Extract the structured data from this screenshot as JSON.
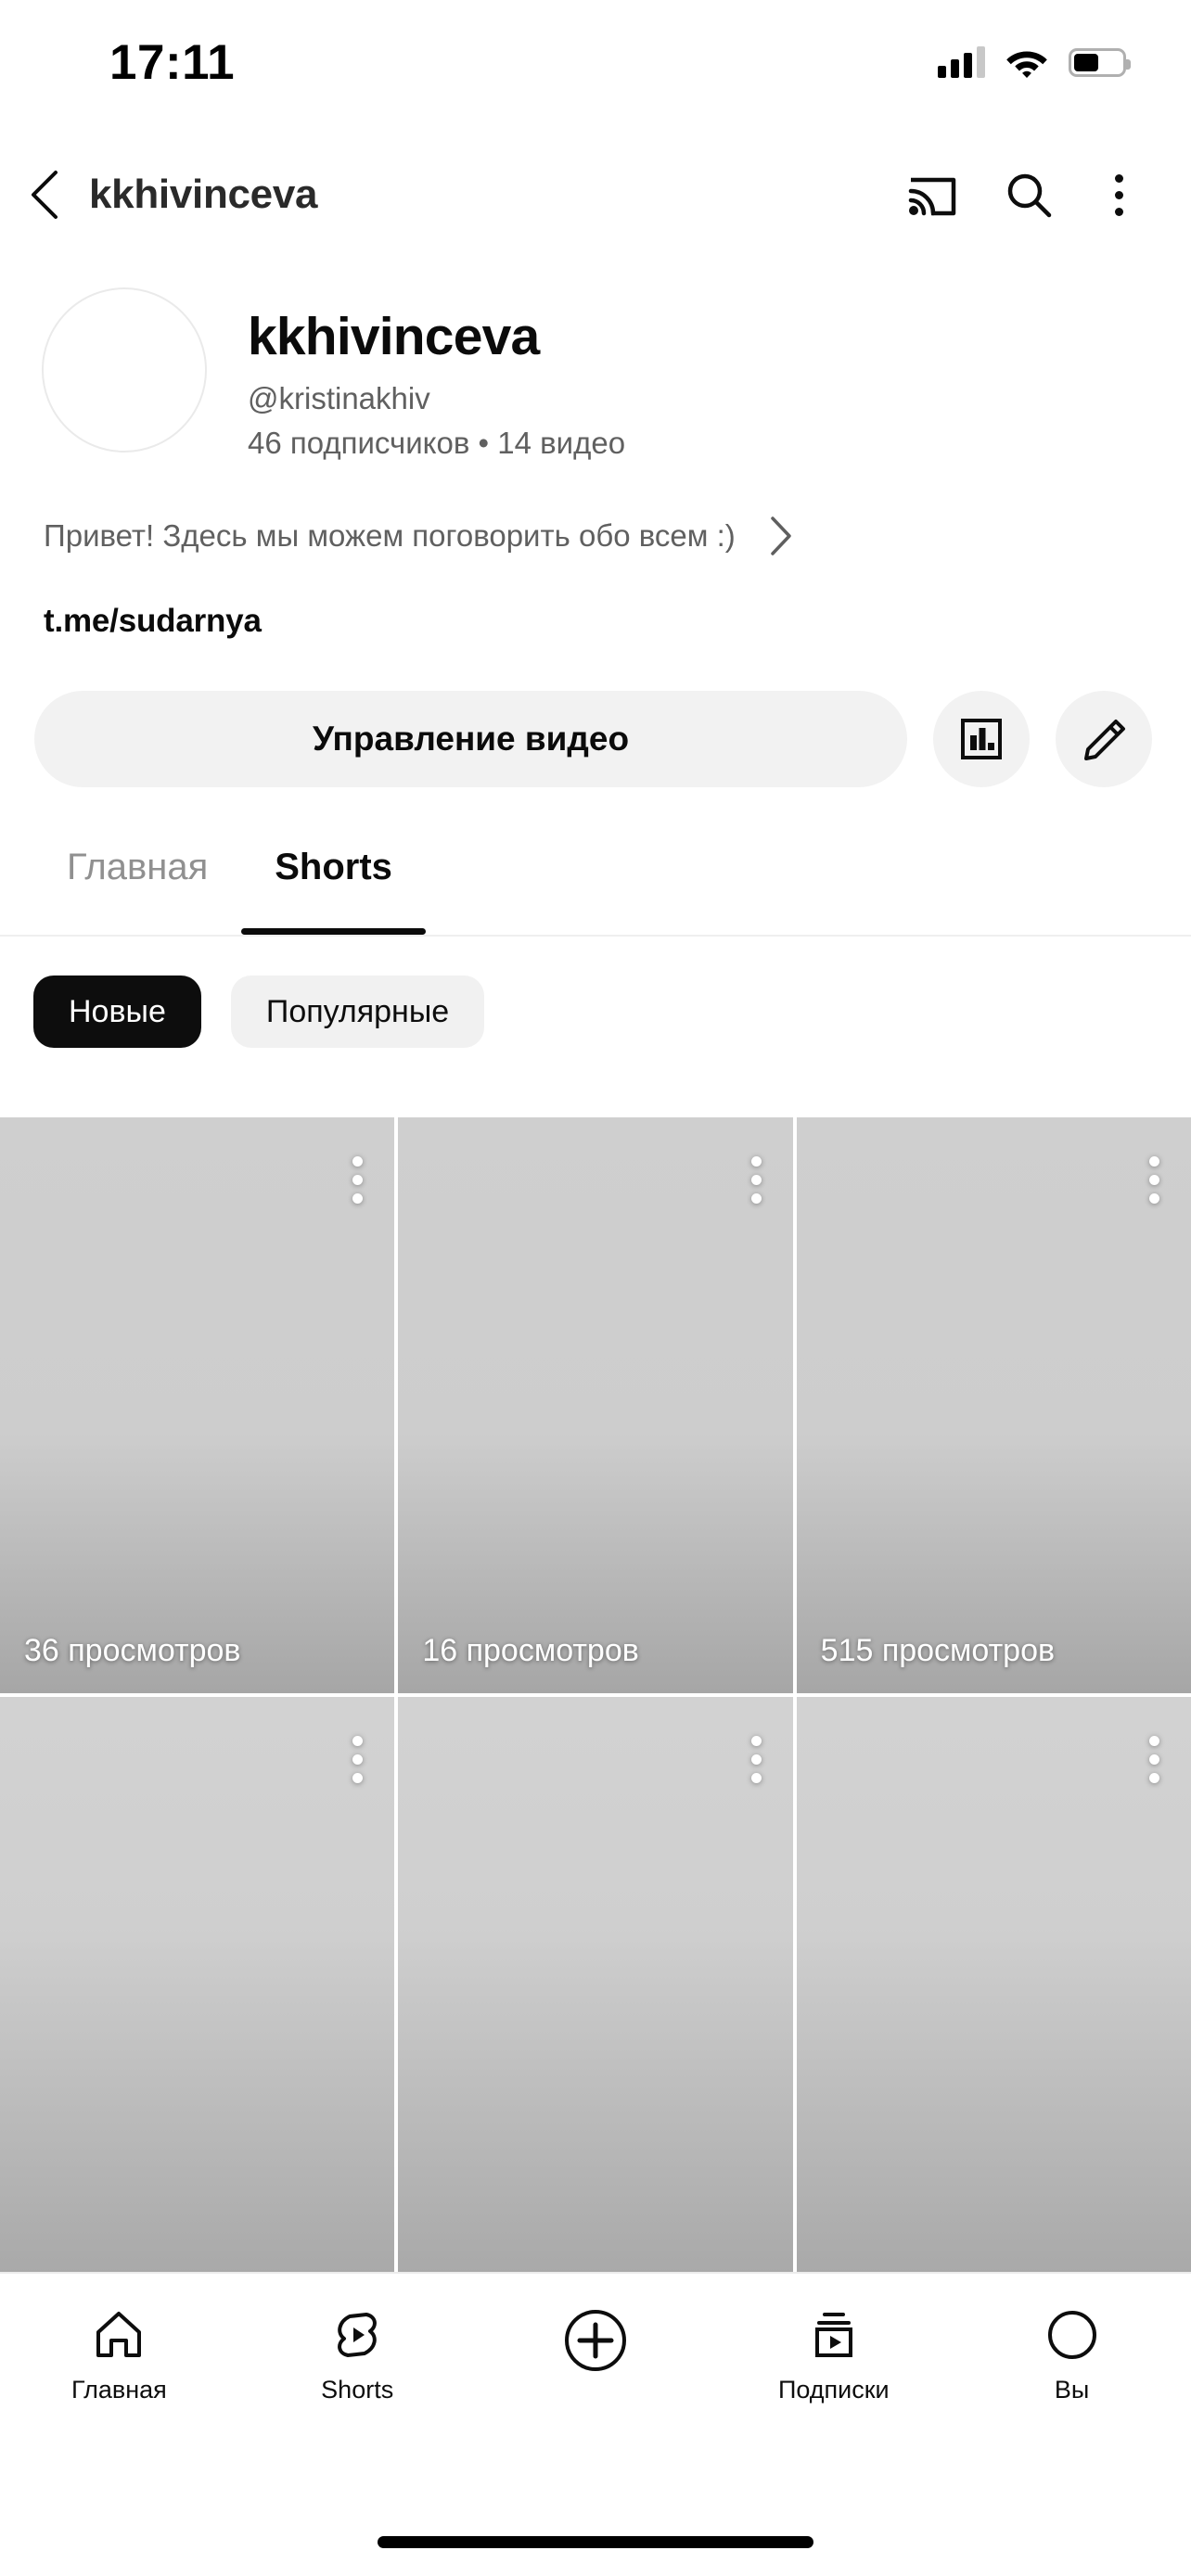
{
  "status_bar": {
    "time": "17:11",
    "signal_icon": "cellular-signal-icon",
    "wifi_icon": "wifi-icon",
    "battery_icon": "battery-icon",
    "battery_level_percent": 52
  },
  "app_bar": {
    "back_icon": "chevron-left-icon",
    "title": "kkhivinceva",
    "cast_icon": "cast-icon",
    "search_icon": "search-icon",
    "overflow_icon": "kebab-menu-icon"
  },
  "profile": {
    "avatar_icon": "avatar",
    "name": "kkhivinceva",
    "handle": "@kristinakhiv",
    "stats": "46 подписчиков  •  14 видео",
    "subscribers": "46 подписчиков",
    "videos": "14 видео",
    "bio": "Привет! Здесь мы можем поговорить обо всем :)",
    "bio_chevron_icon": "chevron-right-icon",
    "link": "t.me/sudarnya"
  },
  "actions": {
    "manage_videos_label": "Управление видео",
    "analytics_icon": "analytics-bar-chart-icon",
    "edit_icon": "pencil-edit-icon"
  },
  "tabs": [
    {
      "label": "Главная",
      "active": false
    },
    {
      "label": "Shorts",
      "active": true
    }
  ],
  "chips": [
    {
      "label": "Новые",
      "active": true
    },
    {
      "label": "Популярные",
      "active": false
    }
  ],
  "grid": {
    "menu_icon": "kebab-menu-icon",
    "items": [
      {
        "views": "36 просмотров",
        "row": 1
      },
      {
        "views": "16 просмотров",
        "row": 1
      },
      {
        "views": "515 просмотров",
        "row": 1
      },
      {
        "views": "",
        "row": 2
      },
      {
        "views": "",
        "row": 2
      },
      {
        "views": "",
        "row": 2
      }
    ]
  },
  "bottom_nav": [
    {
      "label": "Главная",
      "icon": "home-icon"
    },
    {
      "label": "Shorts",
      "icon": "shorts-icon"
    },
    {
      "label": "",
      "icon": "create-plus-icon"
    },
    {
      "label": "Подписки",
      "icon": "subscriptions-icon"
    },
    {
      "label": "Вы",
      "icon": "you-avatar-icon"
    }
  ],
  "colors": {
    "accent": "#0d0d0d",
    "chip_active_bg": "#0d0d0d",
    "chip_inactive_bg": "#f1f1f1",
    "button_bg": "#f2f2f2",
    "secondary_text": "#606060"
  }
}
